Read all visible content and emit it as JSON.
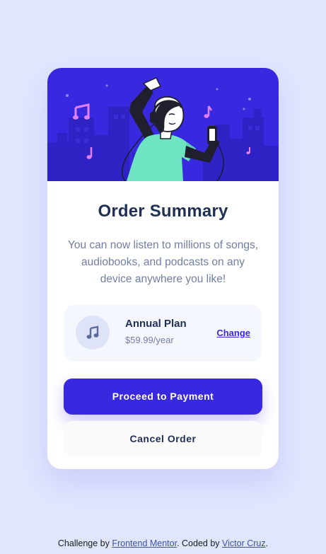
{
  "card": {
    "title": "Order Summary",
    "description": "You can now listen to millions of songs, audiobooks, and podcasts on any device anywhere you like!",
    "plan": {
      "icon": "music-note-icon",
      "name": "Annual Plan",
      "price": "$59.99/year",
      "change_label": "Change"
    },
    "proceed_label": "Proceed to Payment",
    "cancel_label": "Cancel Order"
  },
  "attribution": {
    "prefix": "Challenge by ",
    "link1": "Frontend Mentor",
    "middle": ". Coded by ",
    "link2": "Victor Cruz",
    "suffix": "."
  },
  "colors": {
    "page_background": "#e0e6fe",
    "accent": "#3829e0",
    "dark_text": "#1f2f56",
    "muted_text": "#717fa6"
  }
}
